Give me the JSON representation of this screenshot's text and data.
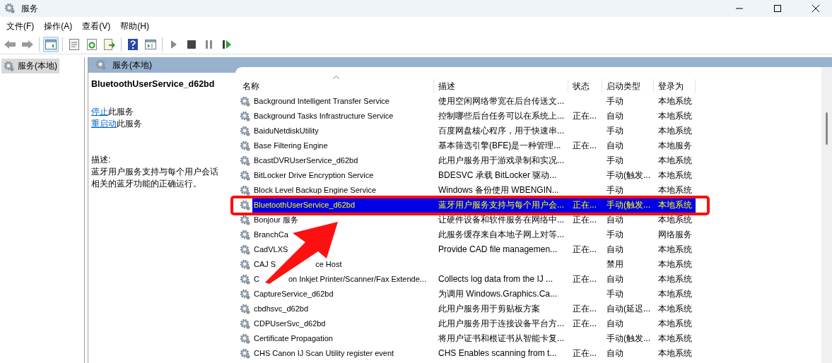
{
  "window": {
    "title": "服务"
  },
  "menu": [
    "文件(F)",
    "操作(A)",
    "查看(V)",
    "帮助(H)"
  ],
  "toolbar": [
    {
      "kind": "back",
      "selected": false
    },
    {
      "kind": "forward",
      "selected": false
    },
    {
      "kind": "tree",
      "selected": true
    },
    {
      "kind": "properties",
      "selected": false
    },
    {
      "kind": "refresh",
      "selected": false
    },
    {
      "kind": "export",
      "selected": false
    },
    {
      "kind": "help",
      "selected": false
    },
    {
      "kind": "pane",
      "selected": false
    },
    {
      "kind": "play",
      "selected": false
    },
    {
      "kind": "stop",
      "selected": false
    },
    {
      "kind": "pause",
      "selected": false
    },
    {
      "kind": "resume",
      "selected": false
    }
  ],
  "tree": [
    {
      "label": "服务(本地)",
      "selected": true
    }
  ],
  "panel_title": "服务(本地)",
  "details": {
    "service": "BluetoothUserService_d62bd",
    "actions": [
      {
        "link": "停止",
        "text": "此服务"
      },
      {
        "link": "重启动",
        "text": "此服务"
      }
    ],
    "description_label": "描述:",
    "description": "蓝牙用户服务支持与每个用户会话相关的蓝牙功能的正确运行。"
  },
  "table": {
    "columns": [
      "名称",
      "描述",
      "状态",
      "启动类型",
      "登录为"
    ],
    "rows": [
      {
        "name": [
          "Background Intelligent Transfer Service"
        ],
        "description": "使用空闲网络带宽在后台传送文...",
        "status": "",
        "startup": "手动",
        "logon": "本地系统",
        "selected": false
      },
      {
        "name": [
          "Background Tasks Infrastructure Service"
        ],
        "description": "控制哪些后台任务可以在系统上...",
        "status": "正在...",
        "startup": "自动",
        "logon": "本地系统",
        "selected": false
      },
      {
        "name": [
          "BaiduNetdiskUtility"
        ],
        "description": "百度网盘核心程序，用于快速串...",
        "status": "",
        "startup": "手动",
        "logon": "本地系统",
        "selected": false
      },
      {
        "name": [
          "Base Filtering Engine"
        ],
        "description": "基本筛选引擎(BFE)是一种管理...",
        "status": "正在...",
        "startup": "自动",
        "logon": "本地服务",
        "selected": false
      },
      {
        "name": [
          "BcastDVRUserService_d62bd"
        ],
        "description": "此用户服务用于游戏录制和实况...",
        "status": "",
        "startup": "手动",
        "logon": "本地系统",
        "selected": false
      },
      {
        "name": [
          "BitLocker Drive Encryption Service"
        ],
        "description": "BDESVC 承载 BitLocker 驱动...",
        "status": "",
        "startup": "手动(触发...",
        "logon": "本地系统",
        "selected": false
      },
      {
        "name": [
          "Block Level Backup Engine Service"
        ],
        "description": "Windows 备份使用 WBENGIN...",
        "status": "",
        "startup": "手动",
        "logon": "本地系统",
        "selected": false
      },
      {
        "name": [
          "BluetoothUserService_d62bd"
        ],
        "description": "蓝牙用户服务支持与每个用户会...",
        "status": "正在...",
        "startup": "手动(触发...",
        "logon": "本地系统",
        "selected": true
      },
      {
        "name": [
          "Bonjour 服务"
        ],
        "description": "让硬件设备和软件服务在网络中...",
        "status": "正在...",
        "startup": "自动",
        "logon": "本地系统",
        "selected": false
      },
      {
        "name": [
          "BranchCa"
        ],
        "description": "此服务缓存来自本地子网上对等...",
        "status": "",
        "startup": "手动",
        "logon": "网络服务",
        "selected": false
      },
      {
        "name": [
          "CadVLXS"
        ],
        "description": "Provide CAD file managemen...",
        "status": "正在...",
        "startup": "自动",
        "logon": "本地系统",
        "selected": false
      },
      {
        "name": [
          "CAJ S",
          "ce Host"
        ],
        "description": "",
        "status": "",
        "startup": "禁用",
        "logon": "本地系统",
        "selected": false
      },
      {
        "name": [
          "C",
          "on Inkjet Printer/Scanner/Fax Extende..."
        ],
        "description": "Collects log data from the IJ ...",
        "status": "正在...",
        "startup": "自动",
        "logon": "本地系统",
        "selected": false
      },
      {
        "name": [
          "CaptureService_d62bd"
        ],
        "description": "为调用 Windows.Graphics.Ca...",
        "status": "",
        "startup": "手动",
        "logon": "本地系统",
        "selected": false
      },
      {
        "name": [
          "cbdhsvc_d62bd"
        ],
        "description": "此用户服务用于剪贴板方案",
        "status": "正在...",
        "startup": "自动(延迟...",
        "logon": "本地系统",
        "selected": false
      },
      {
        "name": [
          "CDPUserSvc_d62bd"
        ],
        "description": "此用户服务用于连接设备平台方...",
        "status": "正在...",
        "startup": "自动",
        "logon": "本地系统",
        "selected": false
      },
      {
        "name": [
          "Certificate Propagation"
        ],
        "description": "将用户证书和根证书从智能卡复...",
        "status": "",
        "startup": "手动(触发...",
        "logon": "本地系统",
        "selected": false
      },
      {
        "name": [
          "CHS Canon IJ Scan Utility register event"
        ],
        "description": "CHS Enables scanning from t...",
        "status": "正在...",
        "startup": "自动",
        "logon": "本地系统",
        "selected": false
      }
    ]
  }
}
